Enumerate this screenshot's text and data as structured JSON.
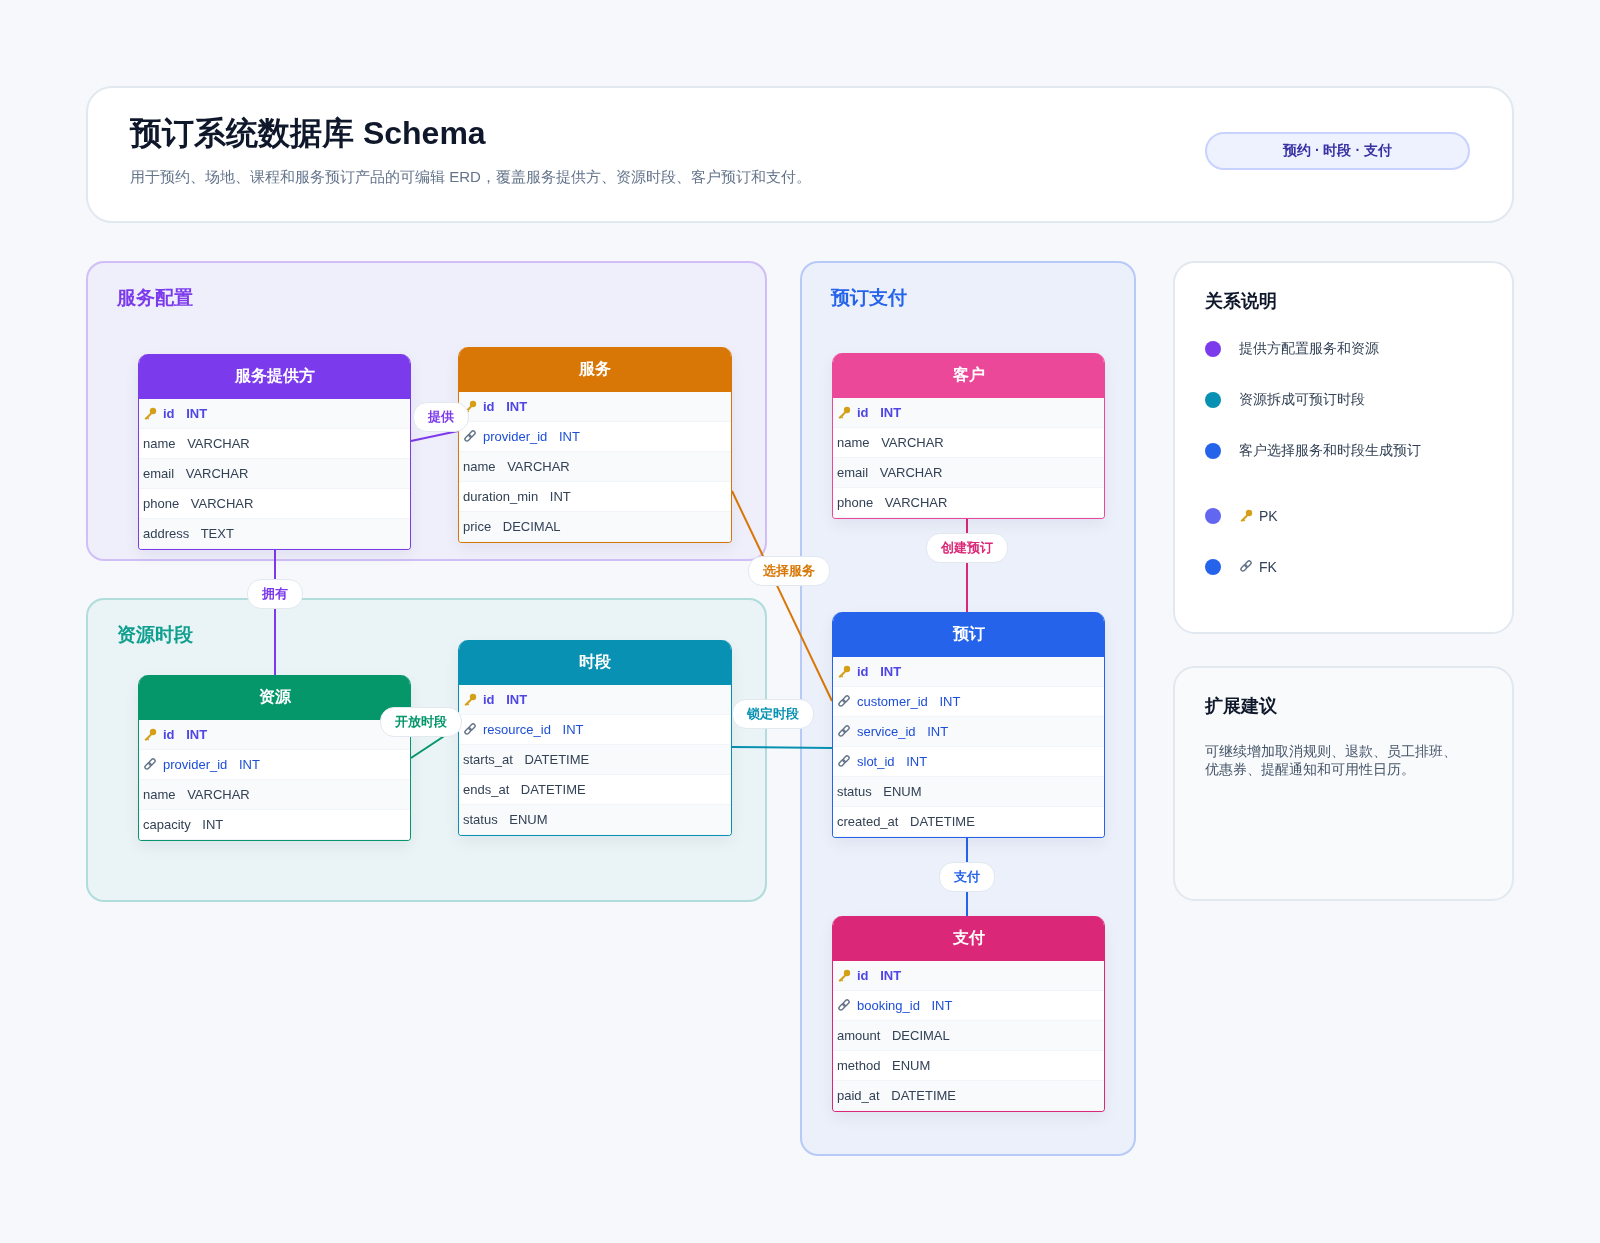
{
  "header": {
    "title": "预订系统数据库 Schema",
    "subtitle": "用于预约、场地、课程和服务预订产品的可编辑 ERD，覆盖服务提供方、资源时段、客户预订和支付。",
    "badge": "预约 · 时段 · 支付"
  },
  "groups": [
    {
      "title": "服务配置",
      "color": "#7c3aed"
    },
    {
      "title": "资源时段",
      "color": "#0f9f8f"
    },
    {
      "title": "预订支付",
      "color": "#2563eb"
    }
  ],
  "tables": [
    {
      "title": "服务提供方",
      "color": "#7c3aed",
      "columns": [
        {
          "name": "id",
          "type": "INT",
          "kind": "pk"
        },
        {
          "name": "name",
          "type": "VARCHAR",
          "kind": "plain"
        },
        {
          "name": "email",
          "type": "VARCHAR",
          "kind": "plain"
        },
        {
          "name": "phone",
          "type": "VARCHAR",
          "kind": "plain"
        },
        {
          "name": "address",
          "type": "TEXT",
          "kind": "plain"
        }
      ]
    },
    {
      "title": "服务",
      "color": "#d97706",
      "columns": [
        {
          "name": "id",
          "type": "INT",
          "kind": "pk"
        },
        {
          "name": "provider_id",
          "type": "INT",
          "kind": "fk"
        },
        {
          "name": "name",
          "type": "VARCHAR",
          "kind": "plain"
        },
        {
          "name": "duration_min",
          "type": "INT",
          "kind": "plain"
        },
        {
          "name": "price",
          "type": "DECIMAL",
          "kind": "plain"
        }
      ]
    },
    {
      "title": "资源",
      "color": "#059669",
      "columns": [
        {
          "name": "id",
          "type": "INT",
          "kind": "pk"
        },
        {
          "name": "provider_id",
          "type": "INT",
          "kind": "fk"
        },
        {
          "name": "name",
          "type": "VARCHAR",
          "kind": "plain"
        },
        {
          "name": "capacity",
          "type": "INT",
          "kind": "plain"
        }
      ]
    },
    {
      "title": "时段",
      "color": "#0891b2",
      "columns": [
        {
          "name": "id",
          "type": "INT",
          "kind": "pk"
        },
        {
          "name": "resource_id",
          "type": "INT",
          "kind": "fk"
        },
        {
          "name": "starts_at",
          "type": "DATETIME",
          "kind": "plain"
        },
        {
          "name": "ends_at",
          "type": "DATETIME",
          "kind": "plain"
        },
        {
          "name": "status",
          "type": "ENUM",
          "kind": "plain"
        }
      ]
    },
    {
      "title": "客户",
      "color": "#ec4899",
      "columns": [
        {
          "name": "id",
          "type": "INT",
          "kind": "pk"
        },
        {
          "name": "name",
          "type": "VARCHAR",
          "kind": "plain"
        },
        {
          "name": "email",
          "type": "VARCHAR",
          "kind": "plain"
        },
        {
          "name": "phone",
          "type": "VARCHAR",
          "kind": "plain"
        }
      ]
    },
    {
      "title": "预订",
      "color": "#2563eb",
      "columns": [
        {
          "name": "id",
          "type": "INT",
          "kind": "pk"
        },
        {
          "name": "customer_id",
          "type": "INT",
          "kind": "fk"
        },
        {
          "name": "service_id",
          "type": "INT",
          "kind": "fk"
        },
        {
          "name": "slot_id",
          "type": "INT",
          "kind": "fk"
        },
        {
          "name": "status",
          "type": "ENUM",
          "kind": "plain"
        },
        {
          "name": "created_at",
          "type": "DATETIME",
          "kind": "plain"
        }
      ]
    },
    {
      "title": "支付",
      "color": "#db2777",
      "columns": [
        {
          "name": "id",
          "type": "INT",
          "kind": "pk"
        },
        {
          "name": "booking_id",
          "type": "INT",
          "kind": "fk"
        },
        {
          "name": "amount",
          "type": "DECIMAL",
          "kind": "plain"
        },
        {
          "name": "method",
          "type": "ENUM",
          "kind": "plain"
        },
        {
          "name": "paid_at",
          "type": "DATETIME",
          "kind": "plain"
        }
      ]
    }
  ],
  "relations": [
    {
      "label": "提供",
      "color": "#7c3aed"
    },
    {
      "label": "拥有",
      "color": "#7c3aed"
    },
    {
      "label": "选择服务",
      "color": "#d97706"
    },
    {
      "label": "开放时段",
      "color": "#059669"
    },
    {
      "label": "锁定时段",
      "color": "#0891b2"
    },
    {
      "label": "创建预订",
      "color": "#db2777"
    },
    {
      "label": "支付",
      "color": "#2563eb"
    }
  ],
  "legend": {
    "title": "关系说明",
    "items": [
      {
        "kind": "relation",
        "text": "提供方配置服务和资源",
        "color": "#7c3aed"
      },
      {
        "kind": "relation",
        "text": "资源拆成可预订时段",
        "color": "#0891b2"
      },
      {
        "kind": "relation",
        "text": "客户选择服务和时段生成预订",
        "color": "#2563eb"
      },
      {
        "kind": "pk",
        "text": "PK",
        "color": "#6366f1"
      },
      {
        "kind": "fk",
        "text": "FK",
        "color": "#2563eb"
      }
    ]
  },
  "suggestions": {
    "title": "扩展建议",
    "text": "可继续增加取消规则、退款、员工排班、优惠券、提醒通知和可用性日历。"
  }
}
